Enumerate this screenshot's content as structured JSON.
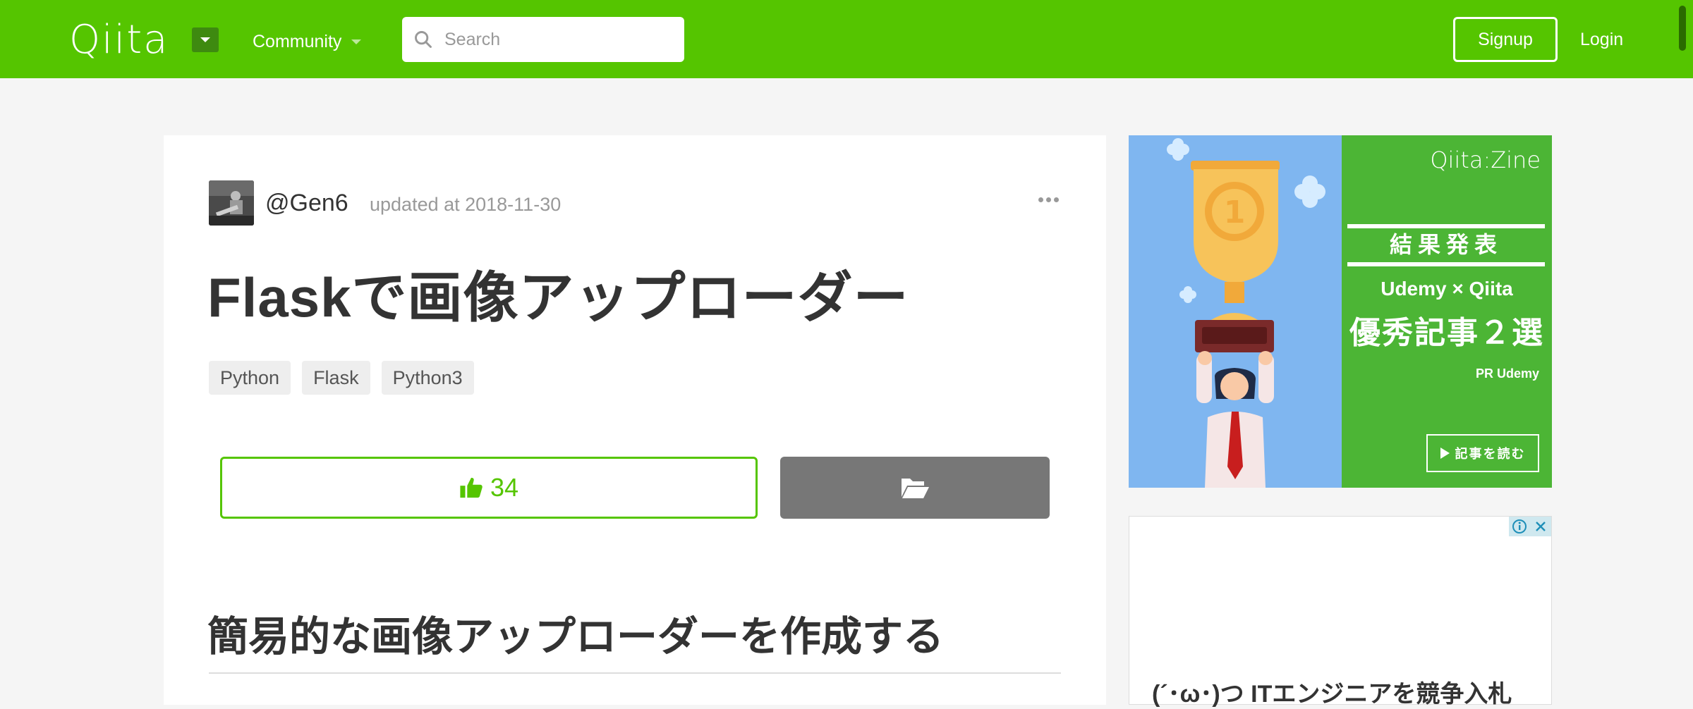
{
  "header": {
    "logo": "Qiita",
    "community_label": "Community",
    "search_placeholder": "Search",
    "signup_label": "Signup",
    "login_label": "Login"
  },
  "article": {
    "author": "@Gen6",
    "updated": "updated at 2018-11-30",
    "title": "Flaskで画像アップローダー",
    "tags": [
      "Python",
      "Flask",
      "Python3"
    ],
    "likes": "34",
    "section_heading": "簡易的な画像アップローダーを作成する"
  },
  "sidebar_ad": {
    "brand": "Qiita:Zine",
    "headline": "結果発表",
    "subline": "Udemy × Qiita",
    "main_copy": "優秀記事２選",
    "pr_label": "PR Udemy",
    "read_button": "記事を読む"
  },
  "sidebar_ad2": {
    "text": "(´･ω･)つ ITエンジニアを競争入札"
  },
  "colors": {
    "brand_green": "#55c500",
    "ad_blue": "#7fb6f0",
    "ad_green": "#4cb535"
  }
}
